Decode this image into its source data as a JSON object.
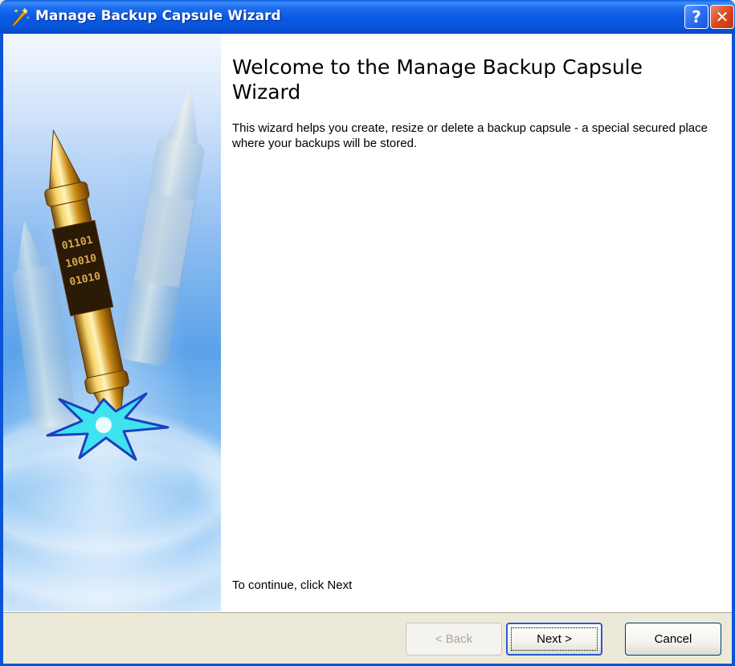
{
  "window": {
    "title": "Manage Backup Capsule Wizard",
    "help_label": "?",
    "close_label": "✕"
  },
  "content": {
    "heading": "Welcome to the Manage Backup Capsule Wizard",
    "description": "This wizard helps you create, resize or delete a backup capsule - a special secured place where your backups will be stored.",
    "continue_text": "To continue, click Next"
  },
  "buttons": {
    "back": "< Back",
    "next": "Next >",
    "cancel": "Cancel"
  },
  "banner": {
    "capsule_binary_1": "01101",
    "capsule_binary_2": "10010",
    "capsule_binary_3": "01010"
  },
  "colors": {
    "title_bar": "#0a56db",
    "dialog_face": "#ece9d8",
    "close_button": "#d9461e"
  }
}
